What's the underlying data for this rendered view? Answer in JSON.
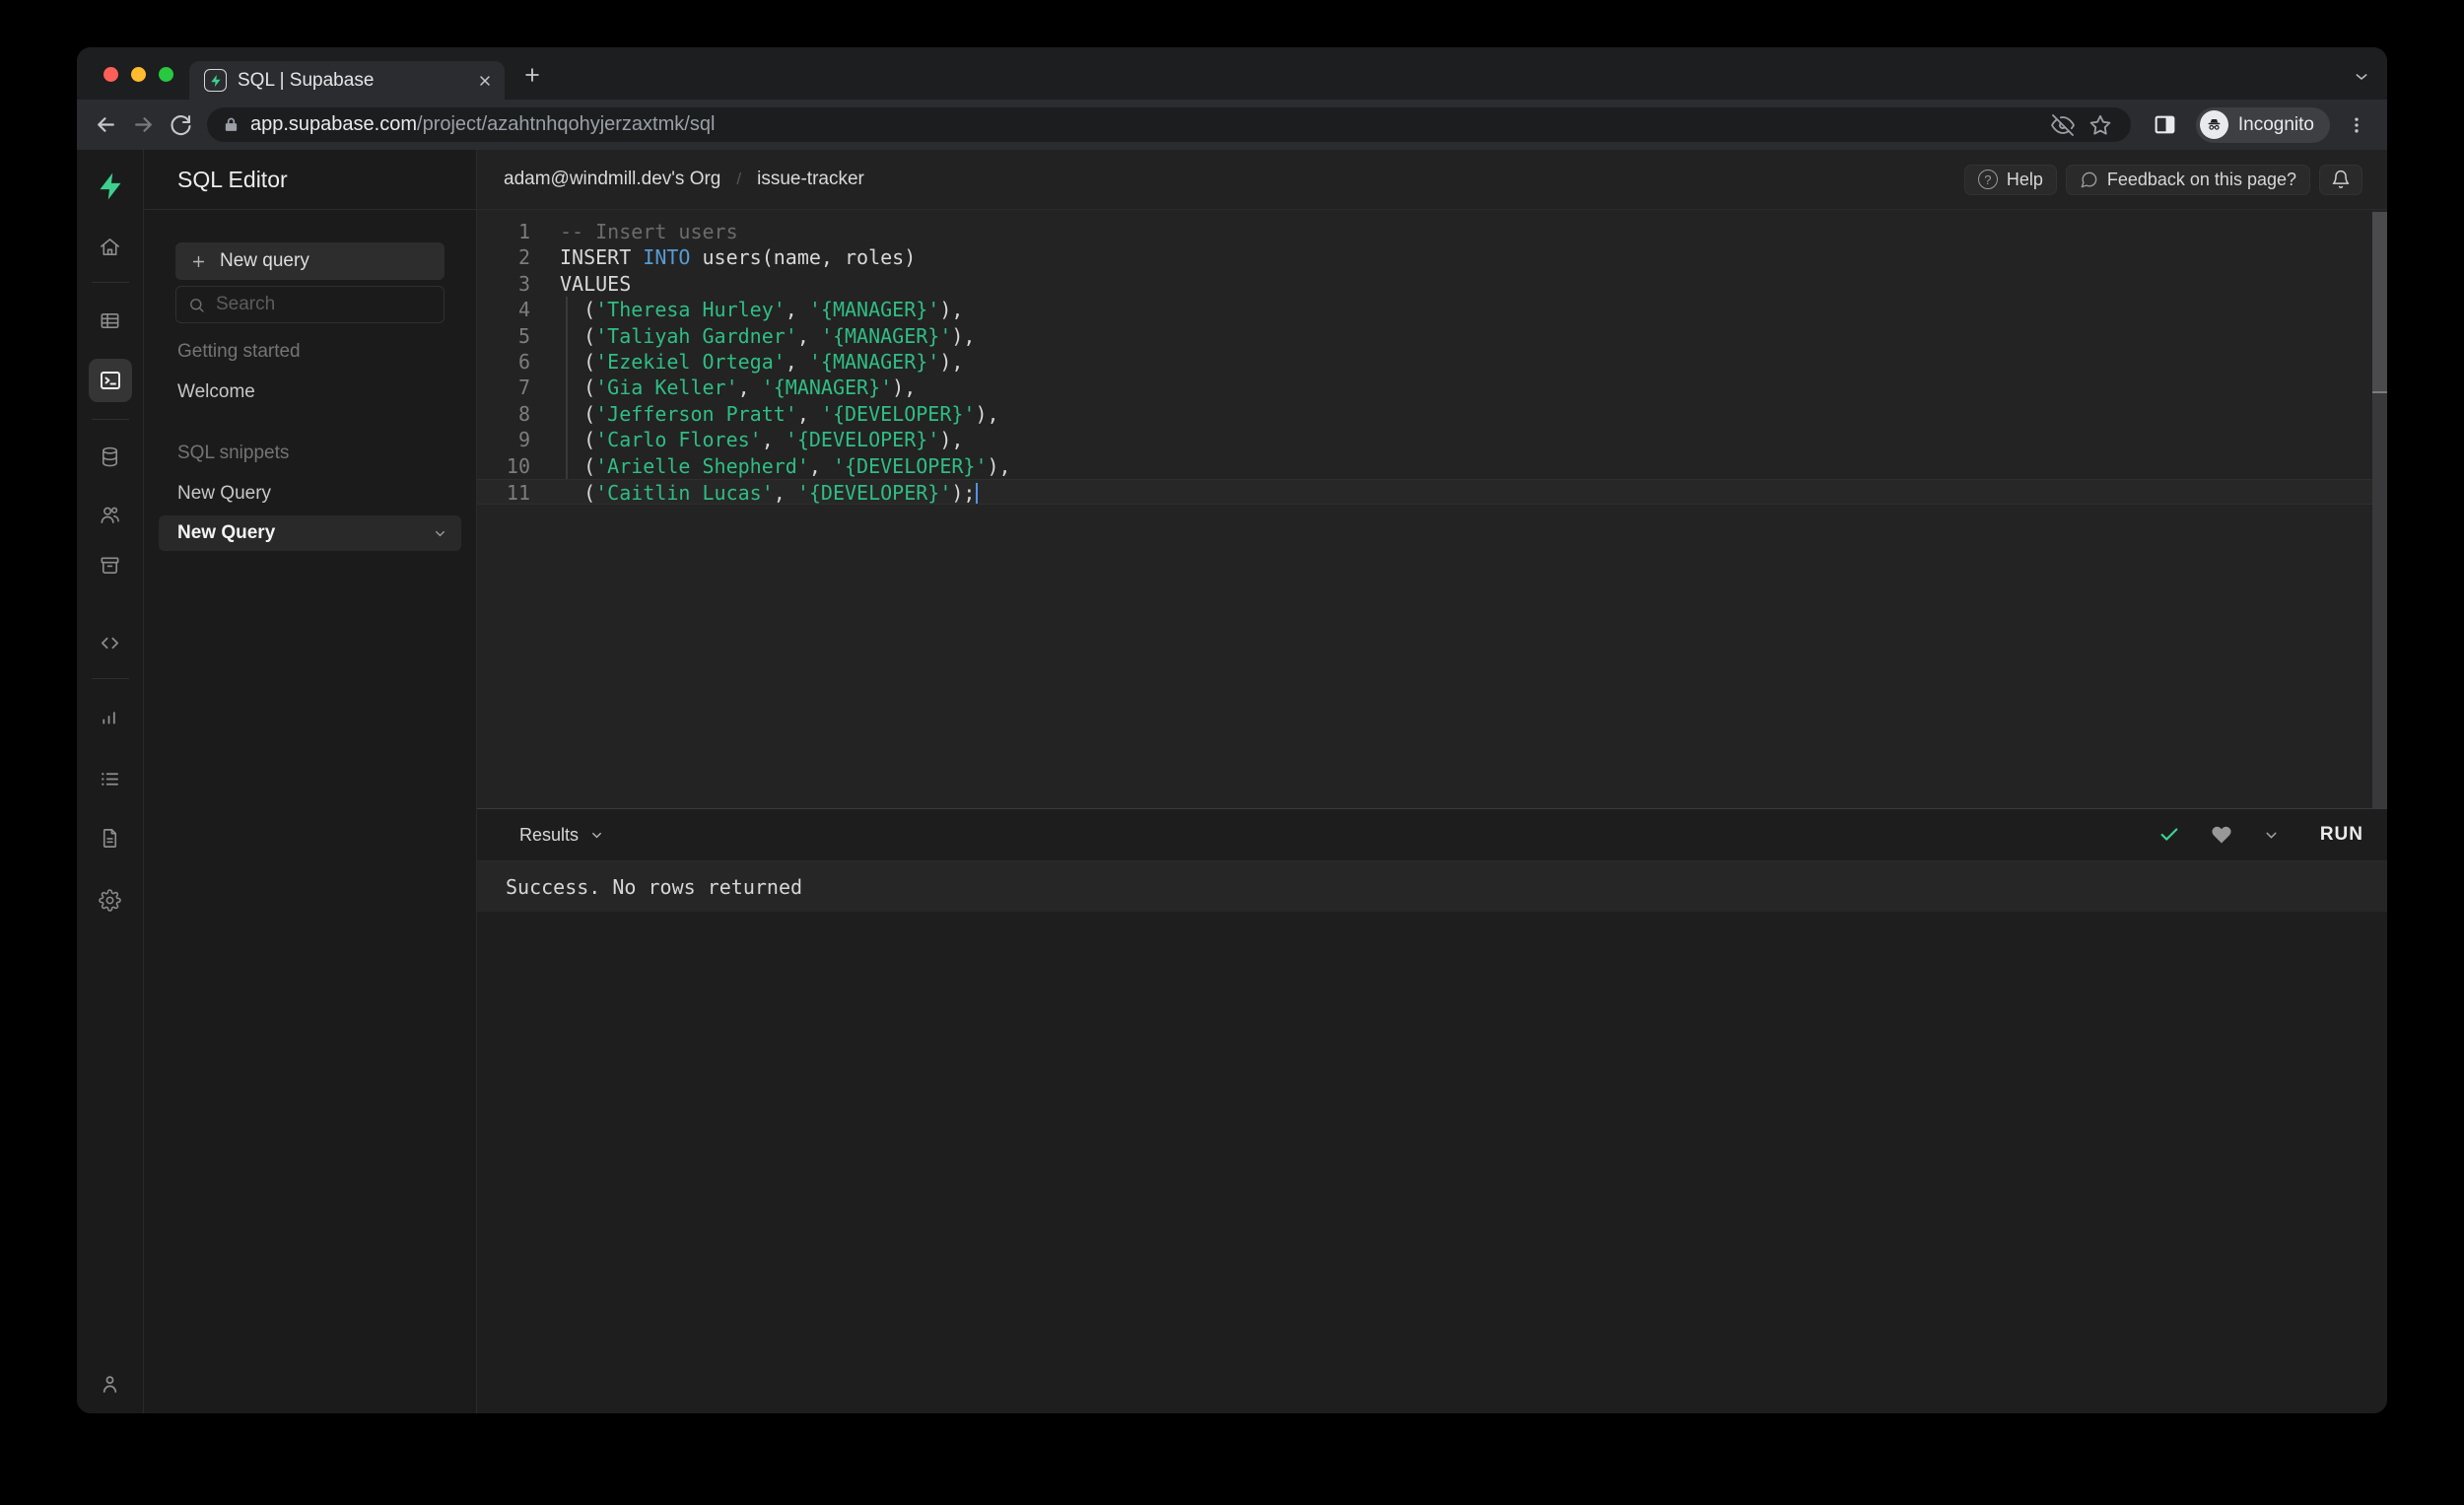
{
  "browser": {
    "tab_title": "SQL | Supabase",
    "url_host": "app.supabase.com",
    "url_path": "/project/azahtnhqohyjerzaxtmk/sql",
    "incognito_label": "Incognito"
  },
  "header": {
    "org": "adam@windmill.dev's Org",
    "separator": "/",
    "project": "issue-tracker",
    "help_label": "Help",
    "feedback_label": "Feedback on this page?"
  },
  "sidebar": {
    "title": "SQL Editor",
    "new_query_button": "New query",
    "search_placeholder": "Search",
    "sections": [
      {
        "label": "Getting started",
        "items": [
          {
            "label": "Welcome",
            "selected": false
          }
        ]
      },
      {
        "label": "SQL snippets",
        "items": [
          {
            "label": "New Query",
            "selected": false
          },
          {
            "label": "New Query",
            "selected": true
          }
        ]
      }
    ]
  },
  "rail_icons": [
    "supabase-logo",
    "home",
    "table-editor",
    "sql-editor",
    "database",
    "authentication",
    "storage",
    "edge-functions",
    "reports",
    "logs",
    "docs",
    "settings",
    "account"
  ],
  "editor": {
    "lines": [
      {
        "num": "1",
        "tokens": [
          [
            "c",
            "-- Insert users"
          ]
        ]
      },
      {
        "num": "2",
        "tokens": [
          [
            "p",
            "INSERT "
          ],
          [
            "k",
            "INTO"
          ],
          [
            "p",
            " users(name, roles)"
          ]
        ]
      },
      {
        "num": "3",
        "tokens": [
          [
            "p",
            "VALUES"
          ]
        ]
      },
      {
        "num": "4",
        "tokens": [
          [
            "p",
            "  ("
          ],
          [
            "s",
            "'Theresa Hurley'"
          ],
          [
            "p",
            ", "
          ],
          [
            "s",
            "'{MANAGER}'"
          ],
          [
            "p",
            "),"
          ]
        ]
      },
      {
        "num": "5",
        "tokens": [
          [
            "p",
            "  ("
          ],
          [
            "s",
            "'Taliyah Gardner'"
          ],
          [
            "p",
            ", "
          ],
          [
            "s",
            "'{MANAGER}'"
          ],
          [
            "p",
            "),"
          ]
        ]
      },
      {
        "num": "6",
        "tokens": [
          [
            "p",
            "  ("
          ],
          [
            "s",
            "'Ezekiel Ortega'"
          ],
          [
            "p",
            ", "
          ],
          [
            "s",
            "'{MANAGER}'"
          ],
          [
            "p",
            "),"
          ]
        ]
      },
      {
        "num": "7",
        "tokens": [
          [
            "p",
            "  ("
          ],
          [
            "s",
            "'Gia Keller'"
          ],
          [
            "p",
            ", "
          ],
          [
            "s",
            "'{MANAGER}'"
          ],
          [
            "p",
            "),"
          ]
        ]
      },
      {
        "num": "8",
        "tokens": [
          [
            "p",
            "  ("
          ],
          [
            "s",
            "'Jefferson Pratt'"
          ],
          [
            "p",
            ", "
          ],
          [
            "s",
            "'{DEVELOPER}'"
          ],
          [
            "p",
            "),"
          ]
        ]
      },
      {
        "num": "9",
        "tokens": [
          [
            "p",
            "  ("
          ],
          [
            "s",
            "'Carlo Flores'"
          ],
          [
            "p",
            ", "
          ],
          [
            "s",
            "'{DEVELOPER}'"
          ],
          [
            "p",
            "),"
          ]
        ]
      },
      {
        "num": "10",
        "tokens": [
          [
            "p",
            "  ("
          ],
          [
            "s",
            "'Arielle Shepherd'"
          ],
          [
            "p",
            ", "
          ],
          [
            "s",
            "'{DEVELOPER}'"
          ],
          [
            "p",
            "),"
          ]
        ]
      },
      {
        "num": "11",
        "tokens": [
          [
            "p",
            "  ("
          ],
          [
            "s",
            "'Caitlin Lucas'"
          ],
          [
            "p",
            ", "
          ],
          [
            "s",
            "'{DEVELOPER}'"
          ],
          [
            "p",
            ");"
          ]
        ],
        "current": true,
        "cursor": true
      }
    ]
  },
  "results": {
    "tab_label": "Results",
    "run_label": "RUN",
    "status_message": "Success. No rows returned"
  },
  "colors": {
    "brand_green": "#3ecf8e",
    "string_green": "#2fbe84",
    "keyword_blue": "#569cd6",
    "check_green": "#3ecf8e",
    "cursor_blue": "#5393ef"
  }
}
